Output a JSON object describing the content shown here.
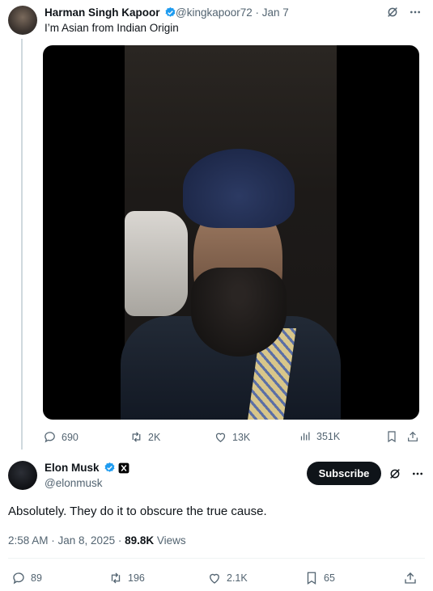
{
  "tweet1": {
    "author_name": "Harman Singh Kapoor",
    "handle": "@kingkapoor72",
    "date": "Jan 7",
    "handle_date": "@kingkapoor72 · Jan 7",
    "text": "I’m Asian from Indian Origin",
    "stats": {
      "replies": "690",
      "retweets": "2K",
      "likes": "13K",
      "views": "351K"
    }
  },
  "tweet2": {
    "author_name": "Elon Musk",
    "handle": "@elonmusk",
    "subscribe_label": "Subscribe",
    "text": "Absolutely. They do it to obscure the true cause.",
    "time": "2:58 AM · Jan 8, 2025 · ",
    "views_count": "89.8K",
    "views_label": " Views",
    "stats": {
      "replies": "89",
      "retweets": "196",
      "likes": "2.1K",
      "bookmarks": "65"
    }
  },
  "colors": {
    "verified_blue": "#1d9bf0",
    "muted_text": "#536471",
    "primary_text": "#0f1419"
  },
  "icons": [
    "more-icon",
    "grok-icon",
    "reply-icon",
    "retweet-icon",
    "like-icon",
    "views-icon",
    "bookmark-icon",
    "share-icon",
    "verified-icon",
    "x-badge-icon"
  ]
}
